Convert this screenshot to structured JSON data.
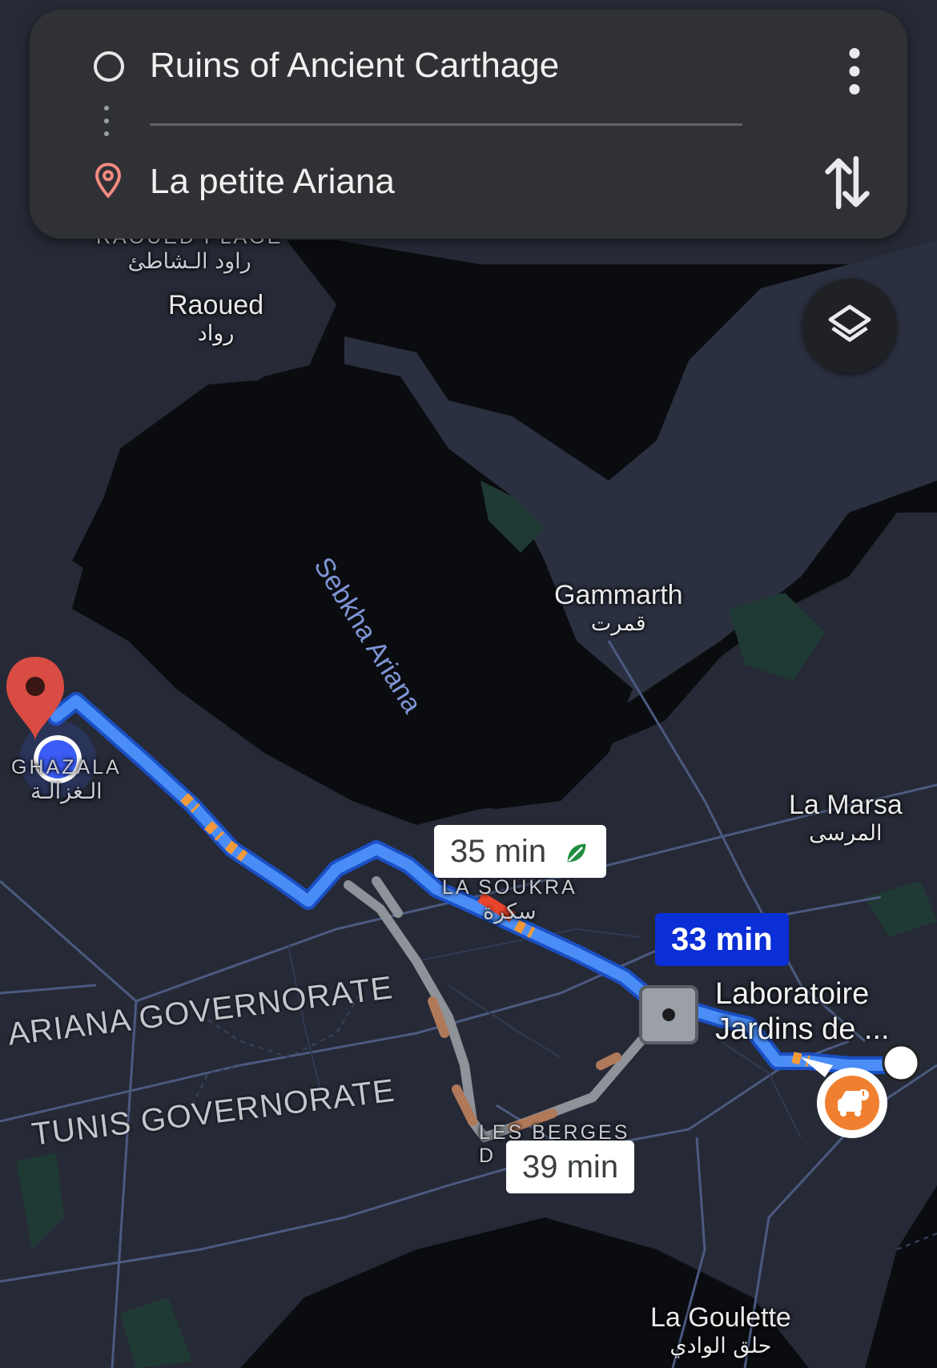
{
  "search_card": {
    "origin": "Ruins of Ancient Carthage",
    "destination": "La petite Ariana"
  },
  "map_labels": {
    "raoued_place": "RAOUED PLAGE",
    "raoued_place_ar": "راود الـشاطئ",
    "raoued": "Raoued",
    "raoued_ar": "رواد",
    "sebkha": "Sebkha Ariana",
    "gammarth": "Gammarth",
    "gammarth_ar": "قمرت",
    "la_marsa": "La Marsa",
    "la_marsa_ar": "المرسى",
    "ghazala": "GHAZALA",
    "ghazala_ar": "الـغزالـة",
    "la_soukra": "LA SOUKRA",
    "la_soukra_ar": "سكرة",
    "ariana_gov": "ARIANA GOVERNORATE",
    "tunis_gov": "TUNIS GOVERNORATE",
    "les_berges": "LES BERGES",
    "les_berges_2": "D",
    "la_goulette": "La Goulette",
    "la_goulette_ar": "حلق الوادي",
    "poi_name_1": "Laboratoire",
    "poi_name_2": "Jardins de ..."
  },
  "routes": [
    {
      "time": "35 min",
      "eco": true,
      "selected": false
    },
    {
      "time": "33 min",
      "eco": false,
      "selected": true
    },
    {
      "time": "39 min",
      "eco": false,
      "selected": false
    }
  ],
  "colors": {
    "route_primary": "#4a8df6",
    "route_alt": "#9aa0a6",
    "traffic_slow": "#f29a3a",
    "traffic_heavy": "#e8452c",
    "selected_bubble": "#0b2fd6",
    "destination_pin": "#d94c43",
    "current_location": "#3b5cf5",
    "card_bg": "#303134"
  },
  "icons": {
    "origin": "circle-outline-icon",
    "destination": "map-pin-icon",
    "menu": "more-vert-icon",
    "swap": "swap-vertical-icon",
    "layers": "layers-icon",
    "eco": "leaf-icon",
    "incident": "car-crash-icon"
  }
}
